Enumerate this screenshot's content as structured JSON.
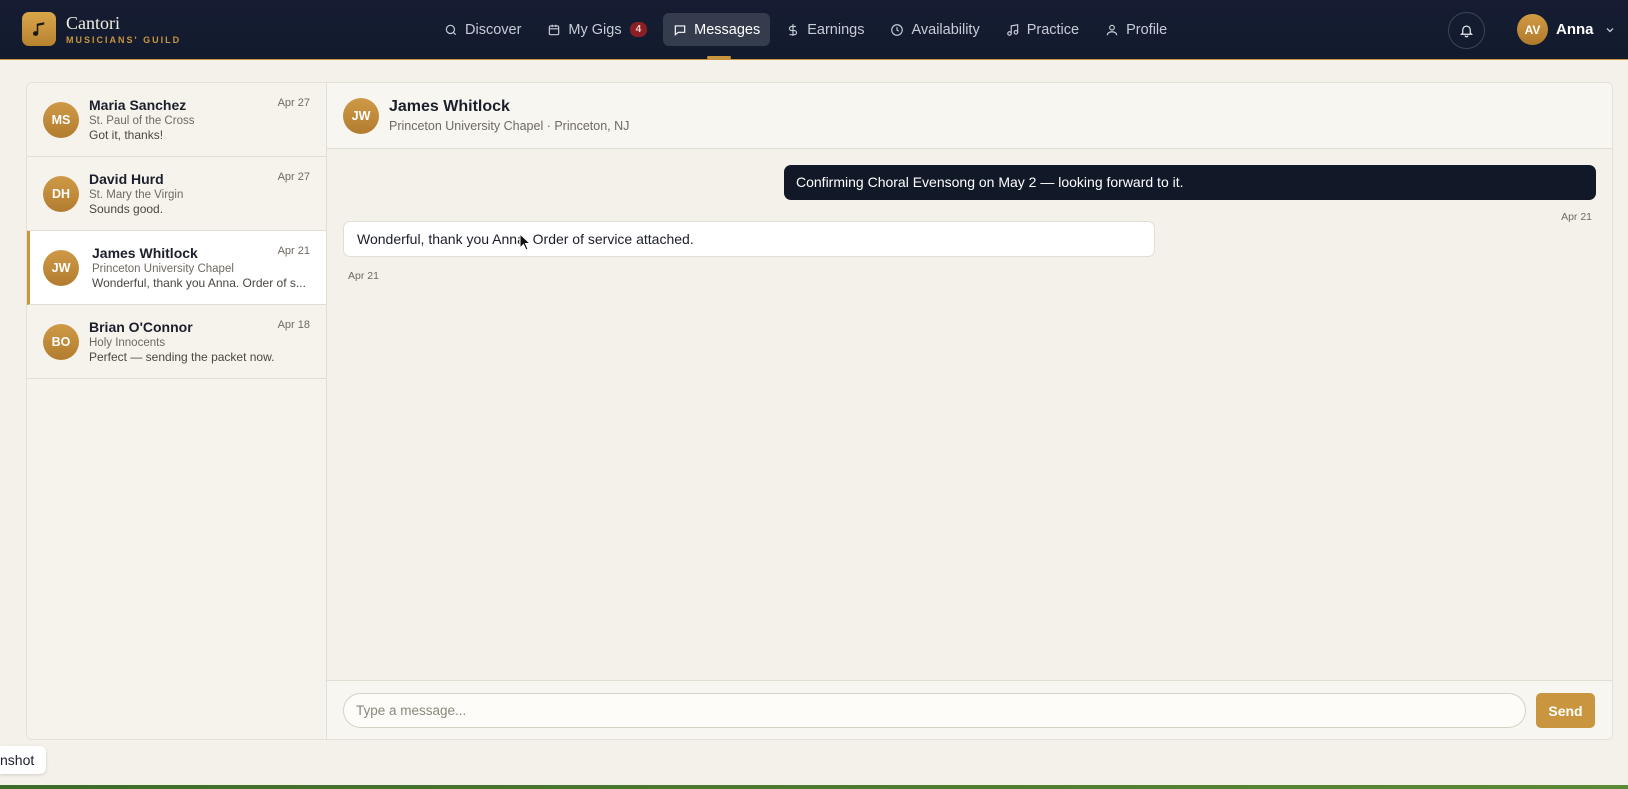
{
  "brand": {
    "name": "Cantori",
    "tagline": "MUSICIANS' GUILD"
  },
  "nav": {
    "items": [
      {
        "label": "Discover",
        "icon": "search-icon"
      },
      {
        "label": "My Gigs",
        "icon": "calendar-icon",
        "badge": "4"
      },
      {
        "label": "Messages",
        "icon": "message-icon",
        "active": true
      },
      {
        "label": "Earnings",
        "icon": "dollar-icon"
      },
      {
        "label": "Availability",
        "icon": "clock-icon"
      },
      {
        "label": "Practice",
        "icon": "music-note-icon"
      },
      {
        "label": "Profile",
        "icon": "user-icon"
      }
    ]
  },
  "user": {
    "initials": "AV",
    "name": "Anna"
  },
  "conversations": [
    {
      "initials": "MS",
      "name": "Maria Sanchez",
      "venue": "St. Paul of the Cross",
      "preview": "Got it, thanks!",
      "date": "Apr 27"
    },
    {
      "initials": "DH",
      "name": "David Hurd",
      "venue": "St. Mary the Virgin",
      "preview": "Sounds good.",
      "date": "Apr 27"
    },
    {
      "initials": "JW",
      "name": "James Whitlock",
      "venue": "Princeton University Chapel",
      "preview": "Wonderful, thank you Anna. Order of s...",
      "date": "Apr 21",
      "active": true
    },
    {
      "initials": "BO",
      "name": "Brian O'Connor",
      "venue": "Holy Innocents",
      "preview": "Perfect — sending the packet now.",
      "date": "Apr 18"
    }
  ],
  "thread": {
    "initials": "JW",
    "name": "James Whitlock",
    "subtitle": "Princeton University Chapel · Princeton, NJ",
    "messages": [
      {
        "direction": "outgoing",
        "text": "Confirming Choral Evensong on May 2 — looking forward to it.",
        "time": "Apr 21"
      },
      {
        "direction": "incoming",
        "text": "Wonderful, thank you Anna. Order of service attached.",
        "time": "Apr 21"
      }
    ]
  },
  "composer": {
    "placeholder": "Type a message...",
    "send_label": "Send"
  },
  "overlay": {
    "screenshot_label": "nshot"
  },
  "colors": {
    "accent": "#c9963f",
    "nav_bg": "#161d33",
    "outgoing_bubble": "#111827",
    "badge": "#8a1f25"
  }
}
